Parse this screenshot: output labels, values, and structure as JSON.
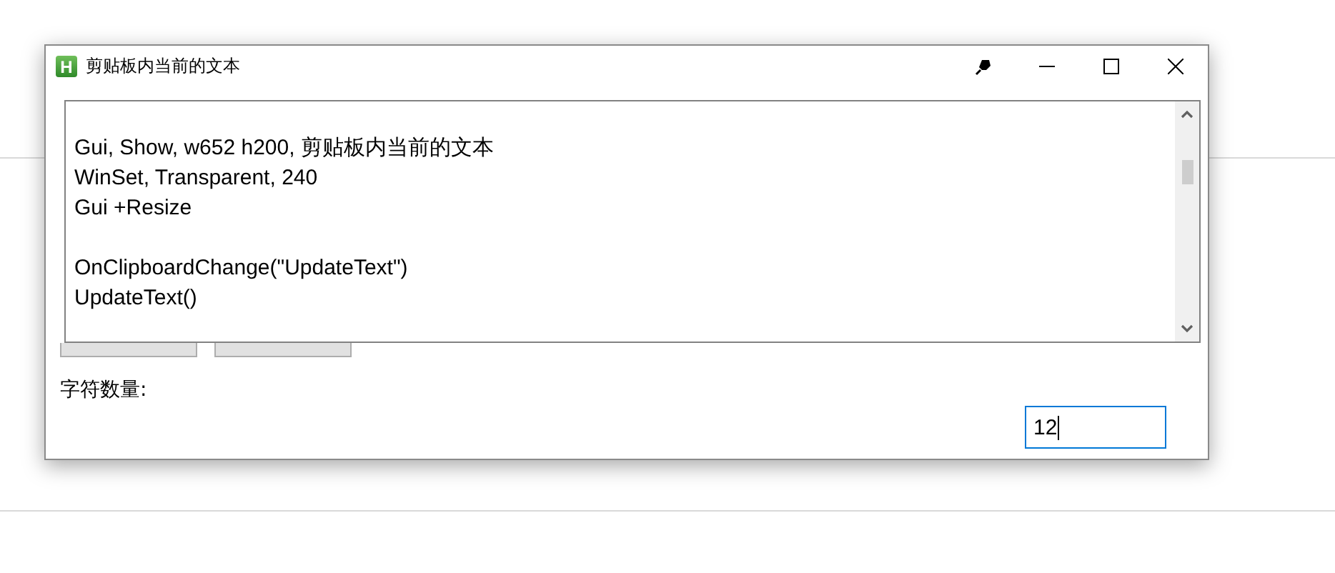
{
  "window": {
    "title": "剪贴板内当前的文本",
    "icon_letter": "H"
  },
  "editor": {
    "text": "Gui, Show, w652 h200, 剪贴板内当前的文本\nWinSet, Transparent, 240\nGui +Resize\n\nOnClipboardChange(\"UpdateText\")\nUpdateText()"
  },
  "buttons": [
    {
      "kind": "push"
    },
    {
      "kind": "push"
    }
  ],
  "count_label": "字符数量:",
  "count_field": {
    "value": "12",
    "focused": true
  }
}
